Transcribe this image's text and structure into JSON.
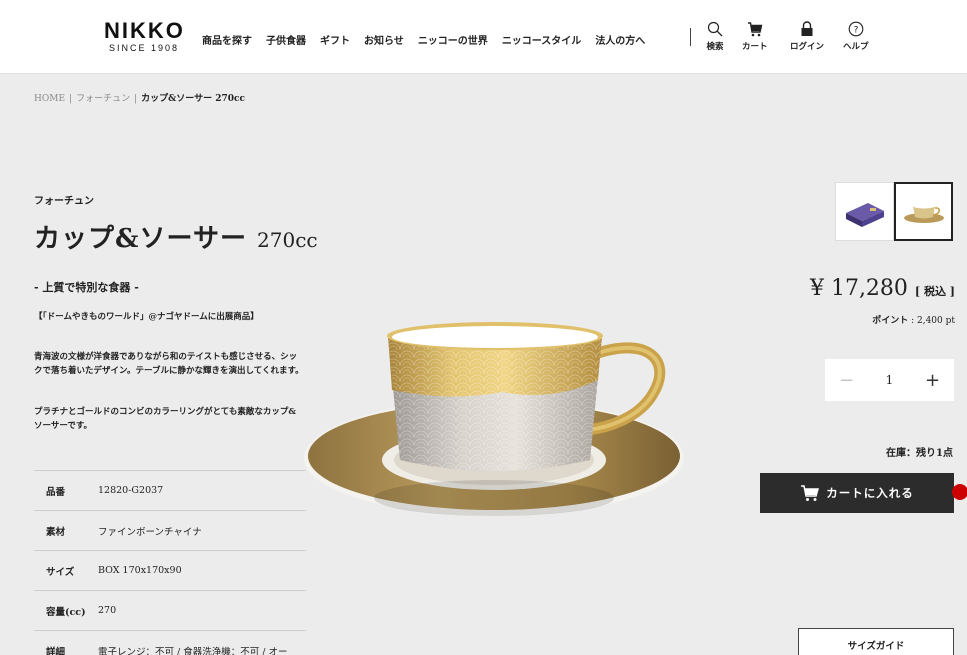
{
  "header": {
    "logo": {
      "main": "NIKKO",
      "sub": "SINCE 1908"
    },
    "nav": [
      "商品を探す",
      "子供食器",
      "ギフト",
      "お知らせ",
      "ニッコーの世界",
      "ニッコースタイル",
      "法人の方へ"
    ],
    "utility": [
      {
        "icon": "search-icon",
        "label": "検索"
      },
      {
        "icon": "cart-icon",
        "label": "カート"
      },
      {
        "icon": "lock-icon",
        "label": "ログイン"
      },
      {
        "icon": "help-icon",
        "label": "ヘルプ"
      }
    ]
  },
  "breadcrumb": [
    "HOME",
    "フォーチュン",
    "カップ&ソーサー 270cc"
  ],
  "product": {
    "series": "フォーチュン",
    "title_main": "カップ&ソーサー",
    "title_capacity": "270cc",
    "tagline": "- 上質で特別な食器 -",
    "desc1": "【「ドームやきものワールド」@ナゴヤドームに出展商品】",
    "desc2": "青海波の文様が洋食器でありながら和のテイストも感じさせる、シックで落ち着いたデザイン。テーブルに静かな輝きを演出してくれます。",
    "desc3": "プラチナとゴールドのコンビのカラーリングがとても素敵なカップ&ソーサーです。",
    "specs": [
      {
        "label": "品番",
        "value": "12820-G2037"
      },
      {
        "label": "素材",
        "value": "ファインボーンチャイナ"
      },
      {
        "label": "サイズ",
        "value": "BOX 170x170x90"
      },
      {
        "label": "容量(cc)",
        "value": "270"
      },
      {
        "label": "詳細",
        "value": "電子レンジ：不可 / 食器洗浄機：不可 / オー"
      }
    ]
  },
  "purchase": {
    "price": "¥ 17,280",
    "tax_label": "[ 税込 ]",
    "points_label": "ポイント",
    "points_value": ": 2,400 pt",
    "qty_minus": "−",
    "quantity": "1",
    "qty_plus": "+",
    "stock": "在庫：残り1点",
    "cart_button": "カートに入れる",
    "size_guide": "サイズガイド"
  },
  "colors": {
    "background": "#ececec",
    "cart_button": "#2c2c2c",
    "gold": "#c9a24a",
    "indicator": "#cc0000"
  }
}
